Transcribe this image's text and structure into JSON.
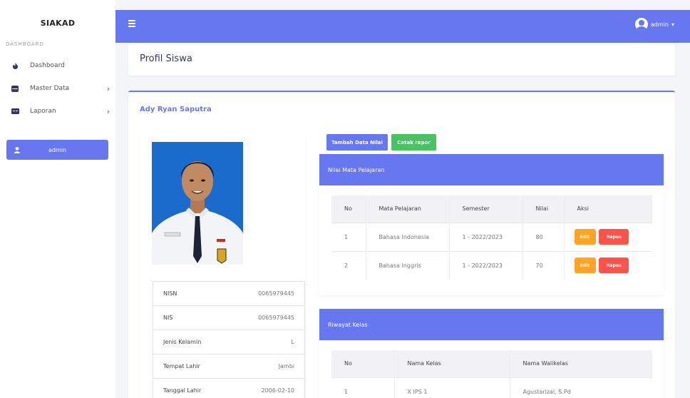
{
  "sidebar": {
    "brand": "SIAKAD",
    "heading": "DASHBOARD",
    "items": [
      {
        "label": "Dashboard",
        "icon": "fire-icon"
      },
      {
        "label": "Master Data",
        "icon": "database-icon"
      },
      {
        "label": "Laporan",
        "icon": "report-icon"
      }
    ],
    "user_label": "admin"
  },
  "topbar": {
    "user_label": "admin",
    "caret": "▾"
  },
  "page": {
    "title": "Profil Siswa"
  },
  "student": {
    "name": "Ady Ryan Saputra",
    "info": [
      {
        "label": "NISN",
        "value": "0065979445"
      },
      {
        "label": "NIS",
        "value": "0065979445"
      },
      {
        "label": "Jenis Kelamin",
        "value": "L"
      },
      {
        "label": "Tempat Lahir",
        "value": "Jambi"
      },
      {
        "label": "Tanggal Lahir",
        "value": "2006-02-10"
      }
    ]
  },
  "actions": {
    "add_grade": "Tambah Data Nilai",
    "print_report": "Cetak rapor"
  },
  "grades": {
    "title": "Nilai Mata Pelajaran",
    "headers": [
      "No",
      "Mata Pelajaran",
      "Semester",
      "Nilai",
      "Aksi"
    ],
    "rows": [
      {
        "no": "1",
        "subject": "Bahasa Indonesia",
        "semester": "1 - 2022/2023",
        "score": "80"
      },
      {
        "no": "2",
        "subject": "Bahasa Inggris",
        "semester": "1 - 2022/2023",
        "score": "70"
      }
    ],
    "edit_label": "Edit",
    "delete_label": "Hapus"
  },
  "class_history": {
    "title": "Riwayat Kelas",
    "headers": [
      "No",
      "Nama Kelas",
      "Nama Walikelas"
    ],
    "rows": [
      {
        "no": "1",
        "class": "X IPS 1",
        "teacher": "Agustarizal, S.Pd"
      }
    ]
  },
  "colors": {
    "primary": "#6777ef",
    "success": "#47c363",
    "warning": "#ffa426",
    "danger": "#fc544b"
  }
}
